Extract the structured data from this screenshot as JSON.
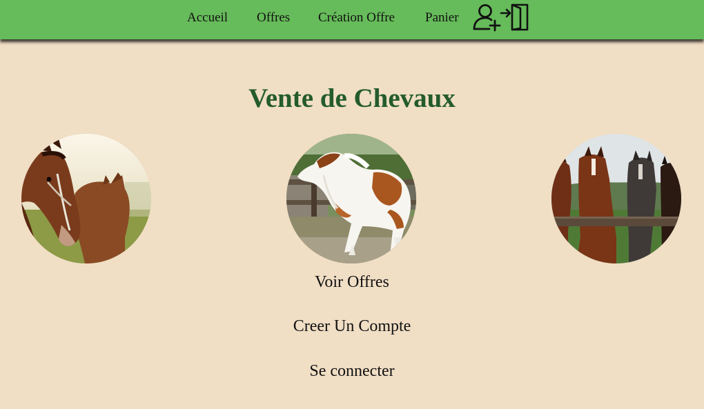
{
  "nav": {
    "accueil": "Accueil",
    "offres": "Offres",
    "creation_offre": "Création Offre",
    "panier": "Panier",
    "icons": [
      "add-user-icon",
      "login-icon"
    ]
  },
  "main": {
    "title": "Vente de Chevaux",
    "images": [
      "two-horses-image",
      "running-horse-image",
      "horses-at-fence-image"
    ],
    "links": {
      "voir_offres": "Voir Offres",
      "creer_compte": "Creer Un Compte",
      "se_connecter": "Se connecter"
    }
  },
  "colors": {
    "navbar": "#66bb5a",
    "background": "#f0dec5",
    "title": "#245b2c"
  }
}
